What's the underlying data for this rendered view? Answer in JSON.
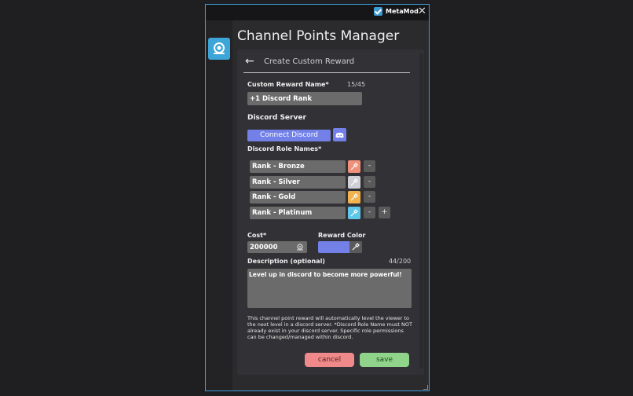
{
  "window": {
    "brand": "MetaMod",
    "close_glyph": "✕",
    "border_color": "#3e9bd6"
  },
  "app": {
    "title": "Channel Points Manager",
    "icon": "channel-points-icon"
  },
  "panel": {
    "back_glyph": "←",
    "title": "Create Custom Reward"
  },
  "form": {
    "reward_name_label": "Custom Reward Name*",
    "reward_name_counter": "15/45",
    "reward_name_value": "+1 Discord Rank",
    "discord_server_label": "Discord Server",
    "connect_label": "Connect Discord",
    "role_names_label": "Discord Role Names*",
    "roles": [
      {
        "name": "Rank - Bronze",
        "color": "#f0907a"
      },
      {
        "name": "Rank - Silver",
        "color": "#cfcfd6"
      },
      {
        "name": "Rank - Gold",
        "color": "#f2b24f"
      },
      {
        "name": "Rank - Platinum",
        "color": "#5fc7e8"
      }
    ],
    "remove_glyph": "-",
    "add_glyph": "+",
    "cost_label": "Cost*",
    "cost_value": "200000",
    "reward_color_label": "Reward Color",
    "reward_color": "#7380e8",
    "description_label": "Description (optional)",
    "description_counter": "44/200",
    "description_value": "Level up in discord to become more powerful!",
    "help_text": "This channel point reward will automatically level the viewer to the next level in a discord server. *Discord Role Name must NOT already exist in your discord server. Specific role permissions can be changed/managed within discord.",
    "cancel_label": "cancel",
    "save_label": "save"
  }
}
